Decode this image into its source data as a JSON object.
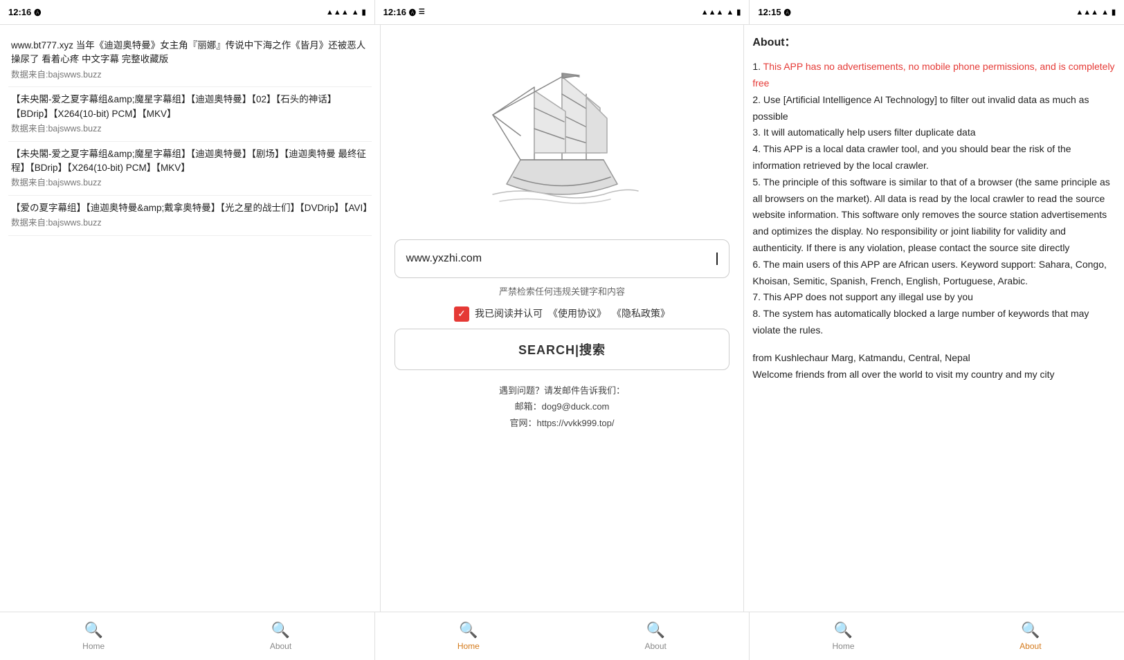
{
  "panels": {
    "left": {
      "status_time": "12:16",
      "results": [
        {
          "text": "www.bt777.xyz 当年《迪迦奥特曼》女主角『丽娜』传说中下海之作《皆月》还被恶人操尿了 看着心疼 中文字幕 完整收藏版",
          "source": "数据来自:bajswws.buzz"
        },
        {
          "text": "【未央閣-爱之夏字幕组&amp;魔星字幕组】【迪迦奥特曼】【02】【石头的神话】【BDrip】【X264(10-bit) PCM】【MKV】",
          "source": "数据来自:bajswws.buzz"
        },
        {
          "text": "【未央閣-爱之夏字幕组&amp;魔星字幕组】【迪迦奥特曼】【剧场】【迪迦奥特曼 最终征程】【BDrip】【X264(10-bit) PCM】【MKV】",
          "source": "数据来自:bajswws.buzz"
        },
        {
          "text": "【爱の夏字幕组】【迪迦奥特曼&amp;戴拿奥特曼】【光之星的战士们】【DVDrip】【AVI】",
          "source": "数据来自:bajswws.buzz"
        }
      ]
    },
    "middle": {
      "status_time": "12:16",
      "search_value": "www.yxzhi.com",
      "search_placeholder": "www.yxzhi.com",
      "warning_text": "严禁检索任何违规关键字和内容",
      "checkbox_label": "我已阅读并认可",
      "agreement1": "《使用协议》",
      "agreement2": "《隐私政策》",
      "search_button": "SEARCH|搜索",
      "contact_label": "遇到问题？请发邮件告诉我们：",
      "email_label": "邮箱：dog9@duck.com",
      "website_label": "官网：https://vvkk999.top/"
    },
    "right": {
      "status_time": "12:15",
      "about_title": "About：",
      "items": [
        {
          "number": "1.",
          "text": "This APP has no advertisements, no mobile phone permissions, and is completely free",
          "highlight": true
        },
        {
          "number": "2.",
          "text": "Use [Artificial Intelligence AI Technology] to filter out invalid data as much as possible",
          "highlight": false
        },
        {
          "number": "3.",
          "text": "It will automatically help users filter duplicate data",
          "highlight": false
        },
        {
          "number": "4.",
          "text": "This APP is a local data crawler tool, and you should bear the risk of the information retrieved by the local crawler.",
          "highlight": false
        },
        {
          "number": "5.",
          "text": "The principle of this software is similar to that of a browser (the same principle as all browsers on the market). All data is read by the local crawler to read the source website information. This software only removes the source station advertisements and optimizes the display. No responsibility or joint liability for validity and authenticity. If there is any violation, please contact the source site directly",
          "highlight": false
        },
        {
          "number": "6.",
          "text": "The main users of this APP are African users. Keyword support: Sahara, Congo, Khoisan, Semitic, Spanish, French, English, Portuguese, Arabic.",
          "highlight": false
        },
        {
          "number": "7.",
          "text": "This APP does not support any illegal use by you",
          "highlight": false
        },
        {
          "number": "8.",
          "text": "The system has automatically blocked a large number of keywords that may violate the rules.",
          "highlight": false
        }
      ],
      "footer": "from Kushlechaur Marg, Katmandu, Central, Nepal\nWelcome friends from all over the world to visit my country and my city"
    }
  },
  "bottom_nav": {
    "left": [
      {
        "label": "Home",
        "active": false
      },
      {
        "label": "About",
        "active": false
      }
    ],
    "middle": [
      {
        "label": "Home",
        "active": false
      },
      {
        "label": "About",
        "active": false
      }
    ],
    "right": [
      {
        "label": "Home",
        "active": false
      },
      {
        "label": "About",
        "active": true
      }
    ]
  },
  "icons": {
    "search": "🔍",
    "check": "✓",
    "signal": "▲▲▲",
    "wifi": "◈",
    "battery": "▮"
  }
}
